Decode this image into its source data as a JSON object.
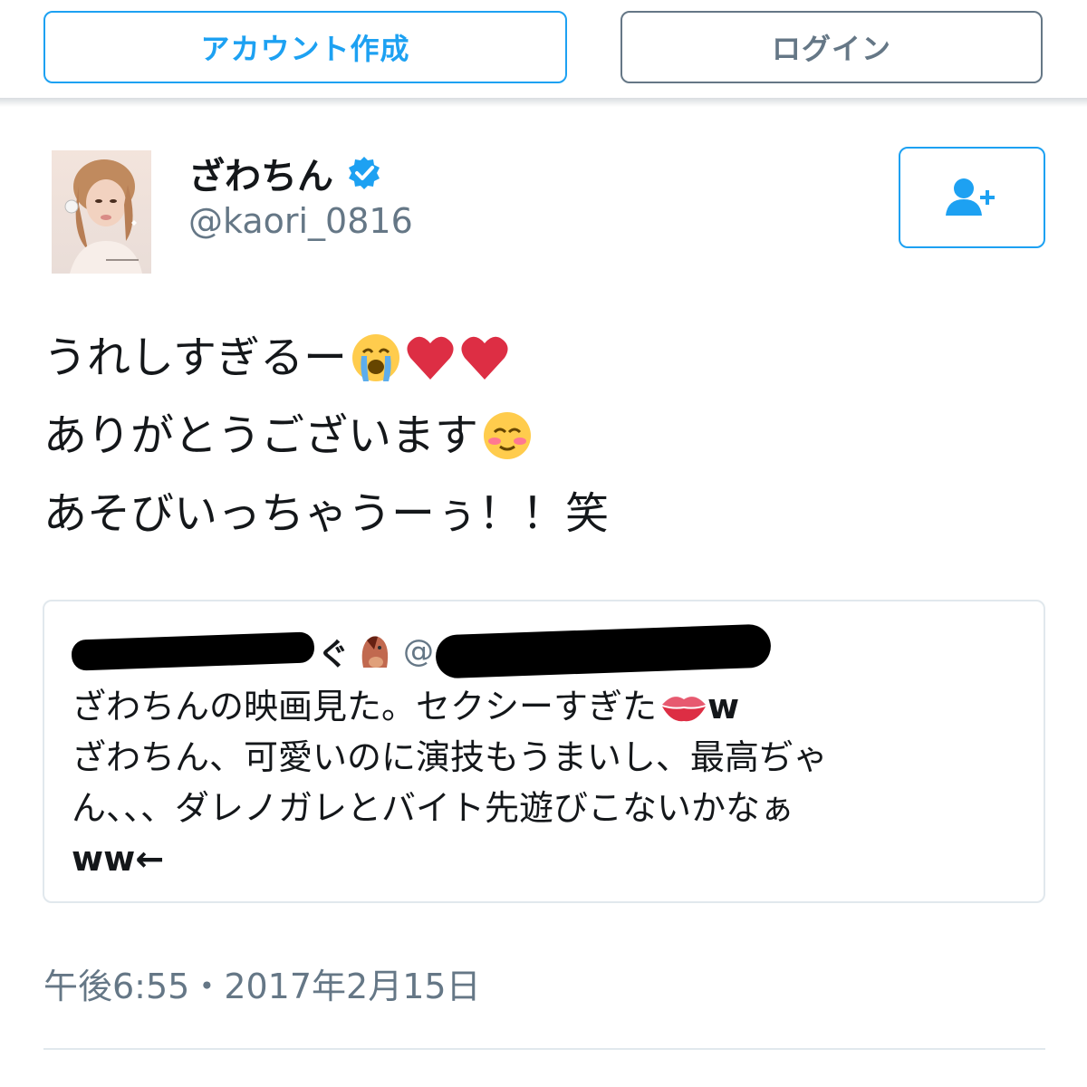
{
  "header": {
    "signup_label": "アカウント作成",
    "login_label": "ログイン"
  },
  "tweet": {
    "author_name": "ざわちん",
    "author_handle": "@kaori_0816",
    "lines": [
      "うれしすぎるー",
      "ありがとうございます",
      "あそびいっちゃうーぅ！！笑"
    ],
    "timestamp": "午後6:55・2017年2月15日"
  },
  "quote": {
    "name_suffix": "ぐ",
    "handle_prefix": "@",
    "lines": [
      "ざわちんの映画見た。セクシーすぎた",
      "ざわちん、可愛いのに演技もうまいし、最高ぢゃ",
      "ん、、、ダレノガレとバイト先遊びこないかなぁ"
    ],
    "line1_suffix": "w",
    "last_line": "ww←"
  },
  "icons": {
    "verified": "verified-badge-icon",
    "follow": "add-user-icon",
    "crying": "loudly-crying-face-icon",
    "heart": "red-heart-icon",
    "blush": "smiling-blushing-face-icon",
    "horse": "horse-face-icon",
    "kiss": "kiss-mark-icon"
  },
  "colors": {
    "accent": "#1da1f2",
    "secondary": "#657786",
    "text": "#14171a",
    "border": "#e1e8ed"
  }
}
